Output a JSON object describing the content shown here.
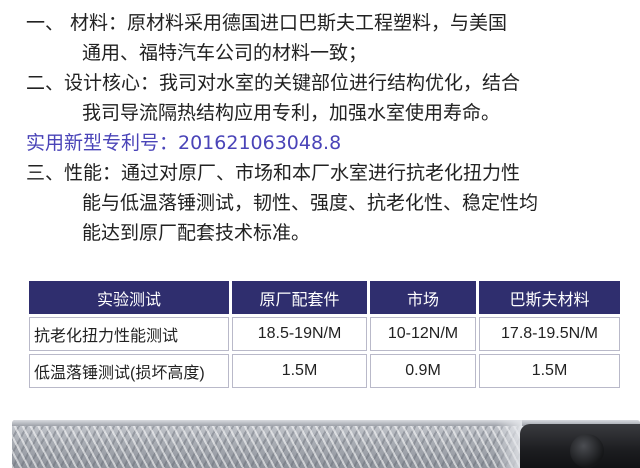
{
  "paragraphs": [
    {
      "lines": [
        "一、 材料：原材料采用德国进口巴斯夫工程塑料，与美国",
        "通用、福特汽车公司的材料一致；"
      ]
    },
    {
      "lines": [
        "二、设计核心：我司对水室的关键部位进行结构优化，结合",
        "我司导流隔热结构应用专利，加强水室使用寿命。"
      ]
    }
  ],
  "patent_number": "实用新型专利号：201621063048.8",
  "performance": {
    "lines": [
      "三、性能：通过对原厂、市场和本厂水室进行抗老化扭力性",
      "能与低温落锤测试，韧性、强度、抗老化性、稳定性均",
      "能达到原厂配套技术标准。"
    ]
  },
  "colors": {
    "header_bg": "#2f2e6e",
    "patent_text": "#4a44b8",
    "cell_border": "#b9b9c9"
  },
  "table": {
    "headers": [
      "实验测试",
      "原厂配套件",
      "市场",
      "巴斯夫材料"
    ],
    "rows": [
      [
        "抗老化扭力性能测试",
        "18.5-19N/M",
        "10-12N/M",
        "17.8-19.5N/M"
      ],
      [
        "低温落锤测试(损坏高度)",
        "1.5M",
        "0.9M",
        "1.5M"
      ]
    ]
  }
}
